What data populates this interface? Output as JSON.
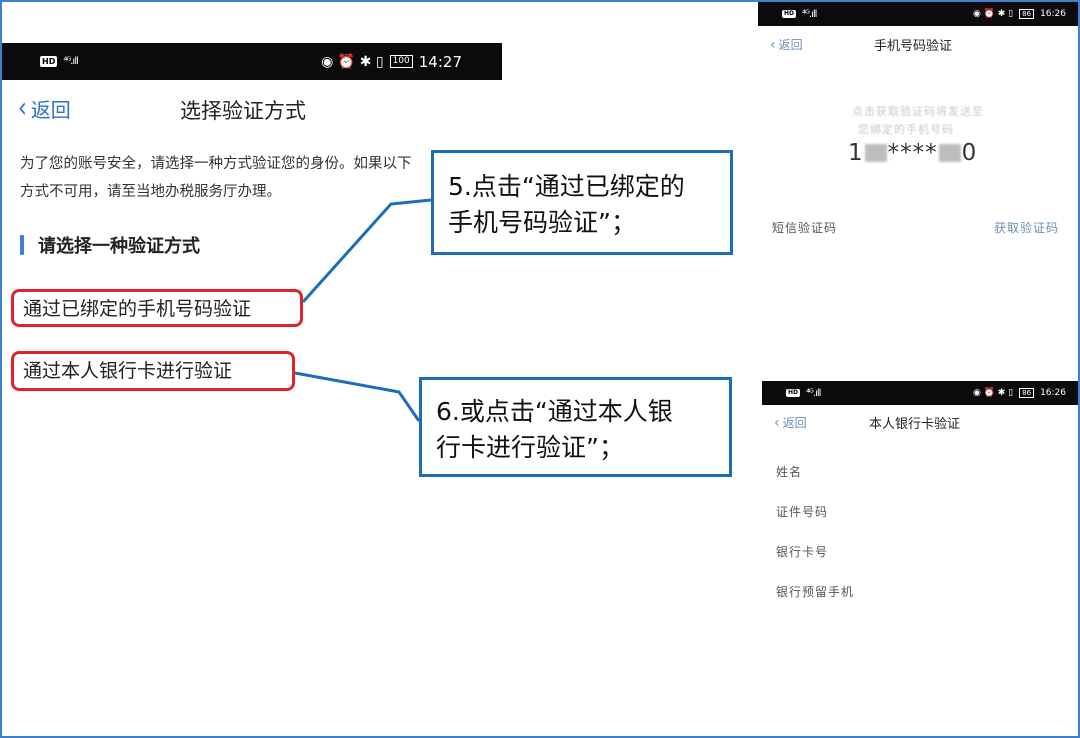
{
  "main": {
    "status": {
      "hd": "HD",
      "signal": "⁴ᴳ.ıll",
      "icons": "◉ ⏰ ✱ ▯ ",
      "battery": "100",
      "time": "14:27"
    },
    "back_label": "返回",
    "title": "选择验证方式",
    "intro_line1": "为了您的账号安全，请选择一种方式验证您的身份。如果以下",
    "intro_line2": "方式不可用，请至当地办税服务厅办理。",
    "section_title": "请选择一种验证方式",
    "option_phone": "通过已绑定的手机号码验证",
    "option_bank": "通过本人银行卡进行验证"
  },
  "callouts": {
    "step5_line1": "5.点击“通过已绑定的",
    "step5_line2": "手机号码验证”；",
    "step6_line1": "6.或点击“通过本人银",
    "step6_line2": "行卡进行验证”；"
  },
  "phone_verify": {
    "status": {
      "hd": "HD",
      "signal": "⁴ᴳ.ıll",
      "icons": "◉ ⏰ ✱ ▯",
      "battery": "86",
      "time": "16:26"
    },
    "back_label": "返回",
    "title": "手机号码验证",
    "blur_line1": "点击获取验证码将发送至",
    "blur_line2": "您绑定的手机号码",
    "number_prefix": "1",
    "number_mask": "****",
    "number_suffix": "0",
    "sms_label": "短信验证码",
    "get_code": "获取验证码"
  },
  "bank_verify": {
    "status": {
      "hd": "HD",
      "signal": "⁴ᴳ.ıll",
      "icons": "◉ ⏰ ✱ ▯",
      "battery": "86",
      "time": "16:26"
    },
    "back_label": "返回",
    "title": "本人银行卡验证",
    "fields": [
      "姓名",
      "证件号码",
      "银行卡号",
      "银行预留手机"
    ]
  },
  "colors": {
    "accent": "#2b6fcf",
    "highlight": "#e0242b",
    "callout_border": "#1d6eb8"
  }
}
